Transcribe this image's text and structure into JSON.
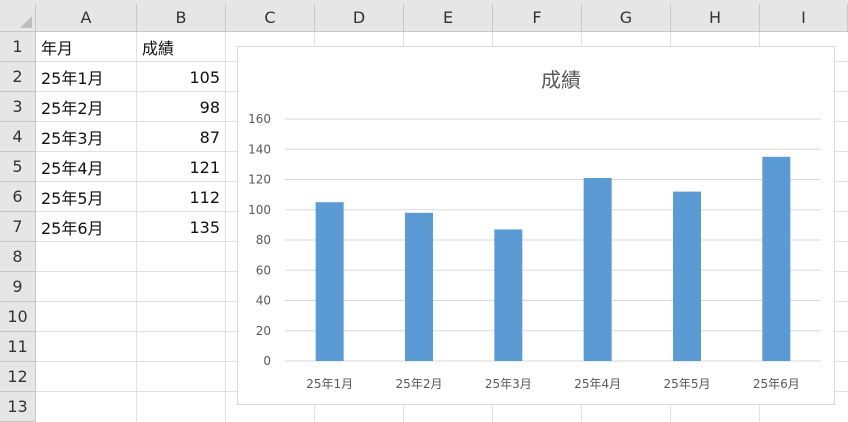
{
  "columns": [
    "A",
    "B",
    "C",
    "D",
    "E",
    "F",
    "G",
    "H",
    "I"
  ],
  "rows": [
    "1",
    "2",
    "3",
    "4",
    "5",
    "6",
    "7",
    "8",
    "9",
    "10",
    "11",
    "12",
    "13"
  ],
  "cells": {
    "header": {
      "a": "年月",
      "b": "成績"
    },
    "data": [
      {
        "month": "25年1月",
        "score": "105"
      },
      {
        "month": "25年2月",
        "score": "98"
      },
      {
        "month": "25年3月",
        "score": "87"
      },
      {
        "month": "25年4月",
        "score": "121"
      },
      {
        "month": "25年5月",
        "score": "112"
      },
      {
        "month": "25年6月",
        "score": "135"
      }
    ]
  },
  "chart_data": {
    "type": "bar",
    "title": "成績",
    "categories": [
      "25年1月",
      "25年2月",
      "25年3月",
      "25年4月",
      "25年5月",
      "25年6月"
    ],
    "values": [
      105,
      98,
      87,
      121,
      112,
      135
    ],
    "ylim": [
      0,
      160
    ],
    "yticks": [
      "0",
      "20",
      "40",
      "60",
      "80",
      "100",
      "120",
      "140",
      "160"
    ],
    "grid": true,
    "legend": "none",
    "bar_color": "#5b9bd5",
    "gridline_color": "#d9d9d9"
  }
}
